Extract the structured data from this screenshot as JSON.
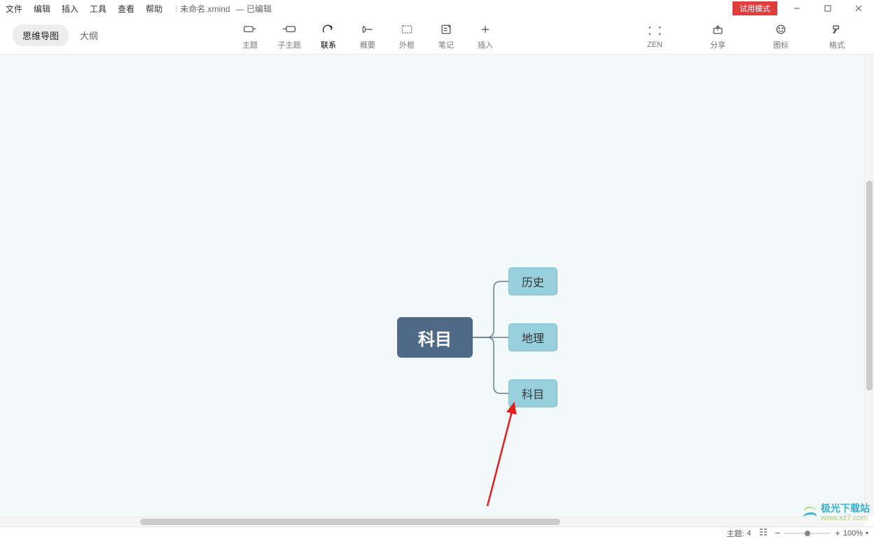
{
  "menus": {
    "file": "文件",
    "edit": "编辑",
    "insert": "插入",
    "tools": "工具",
    "view": "查看",
    "help": "帮助"
  },
  "title": {
    "filename": "未命名.xmind",
    "state": "— 已编辑"
  },
  "badge": {
    "trial": "试用模式"
  },
  "tabs": {
    "mindmap": "思维导图",
    "outline": "大纲"
  },
  "toolbar": {
    "topic": "主题",
    "subtopic": "子主题",
    "relation": "联系",
    "summary": "概要",
    "boundary": "外框",
    "notes": "笔记",
    "insert": "插入",
    "zen": "ZEN",
    "share": "分享",
    "icons": "图标",
    "format": "格式"
  },
  "mindmap": {
    "root": "科目",
    "children": [
      "历史",
      "地理",
      "科目"
    ]
  },
  "status": {
    "topics_label": "主题:",
    "topics_count": "4",
    "zoom": "100%"
  },
  "watermark": {
    "brand": "极光下载站",
    "url": "www.xz7.com"
  }
}
